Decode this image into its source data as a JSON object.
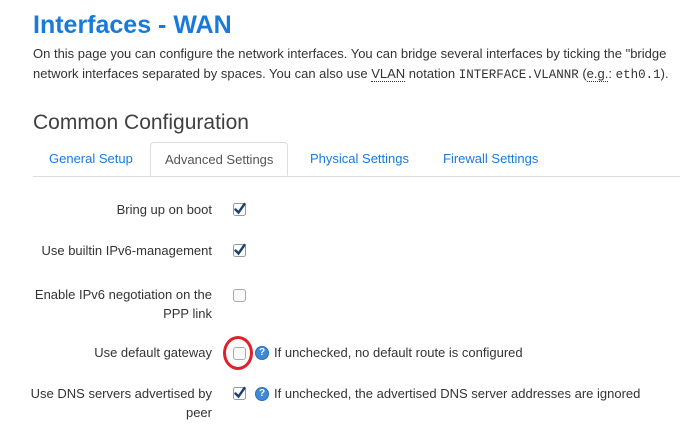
{
  "page": {
    "title": "Interfaces - WAN",
    "intro_line1": "On this page you can configure the network interfaces. You can bridge several interfaces by ticking the \"bridge",
    "intro_line2_pre": "network interfaces separated by spaces. You can also use ",
    "intro_abbr_vlan": "VLAN",
    "intro_line2_mid": " notation ",
    "intro_code_notation": "INTERFACE.VLANNR",
    "intro_line2_paren": " (",
    "intro_abbr_eg": "e.g.",
    "intro_line2_colon": ": ",
    "intro_code_example": "eth0.1",
    "intro_line2_end": ")."
  },
  "section": {
    "title": "Common Configuration"
  },
  "tabs": [
    {
      "label": "General Setup",
      "active": false
    },
    {
      "label": "Advanced Settings",
      "active": true
    },
    {
      "label": "Physical Settings",
      "active": false
    },
    {
      "label": "Firewall Settings",
      "active": false
    }
  ],
  "options": [
    {
      "label": "Bring up on boot",
      "checked": true
    },
    {
      "label": "Use builtin IPv6-management",
      "checked": true
    },
    {
      "label": "Enable IPv6 negotiation on the PPP link",
      "checked": false
    },
    {
      "label": "Use default gateway",
      "checked": false,
      "help_icon": "help-icon",
      "help": "If unchecked, no default route is configured"
    },
    {
      "label": "Use DNS servers advertised by peer",
      "checked": true,
      "help_icon": "help-icon",
      "help": "If unchecked, the advertised DNS server addresses are ignored"
    }
  ],
  "colors": {
    "title": "#1a7ad9",
    "tab_link": "#1a7ad9",
    "highlight_ring": "#e0202a",
    "help_icon": "#3e8ad4"
  }
}
